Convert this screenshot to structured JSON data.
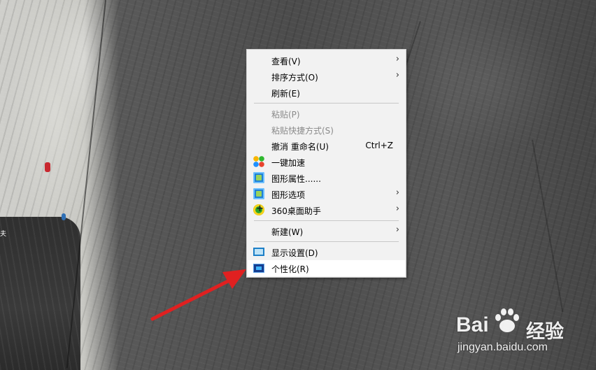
{
  "context_menu": {
    "items": [
      {
        "label": "查看(V)",
        "shortcut": "",
        "submenu": true,
        "disabled": false,
        "icon": ""
      },
      {
        "label": "排序方式(O)",
        "shortcut": "",
        "submenu": true,
        "disabled": false,
        "icon": ""
      },
      {
        "label": "刷新(E)",
        "shortcut": "",
        "submenu": false,
        "disabled": false,
        "icon": ""
      },
      {
        "label": "粘贴(P)",
        "shortcut": "",
        "submenu": false,
        "disabled": true,
        "icon": ""
      },
      {
        "label": "粘贴快捷方式(S)",
        "shortcut": "",
        "submenu": false,
        "disabled": true,
        "icon": ""
      },
      {
        "label": "撤消 重命名(U)",
        "shortcut": "Ctrl+Z",
        "submenu": false,
        "disabled": false,
        "icon": ""
      },
      {
        "label": "一键加速",
        "shortcut": "",
        "submenu": false,
        "disabled": false,
        "icon": "speedup-icon"
      },
      {
        "label": "图形属性......",
        "shortcut": "",
        "submenu": false,
        "disabled": false,
        "icon": "graphics-properties-icon"
      },
      {
        "label": "图形选项",
        "shortcut": "",
        "submenu": true,
        "disabled": false,
        "icon": "graphics-options-icon"
      },
      {
        "label": "360桌面助手",
        "shortcut": "",
        "submenu": true,
        "disabled": false,
        "icon": "360-desktop-icon"
      },
      {
        "label": "新建(W)",
        "shortcut": "",
        "submenu": true,
        "disabled": false,
        "icon": ""
      },
      {
        "label": "显示设置(D)",
        "shortcut": "",
        "submenu": false,
        "disabled": false,
        "icon": "display-settings-icon"
      },
      {
        "label": "个性化(R)",
        "shortcut": "",
        "submenu": false,
        "disabled": false,
        "icon": "personalize-icon",
        "highlighted": true
      }
    ],
    "submenu_arrow": "›"
  },
  "desktop_edge_labels": [
    "夫"
  ],
  "watermark": {
    "brand": "Bai",
    "brand_cn": "经验",
    "url": "jingyan.baidu.com"
  },
  "colors": {
    "menu_bg": "#f2f2f2",
    "menu_highlight": "#ffffff",
    "annotation_arrow": "#e02020"
  }
}
